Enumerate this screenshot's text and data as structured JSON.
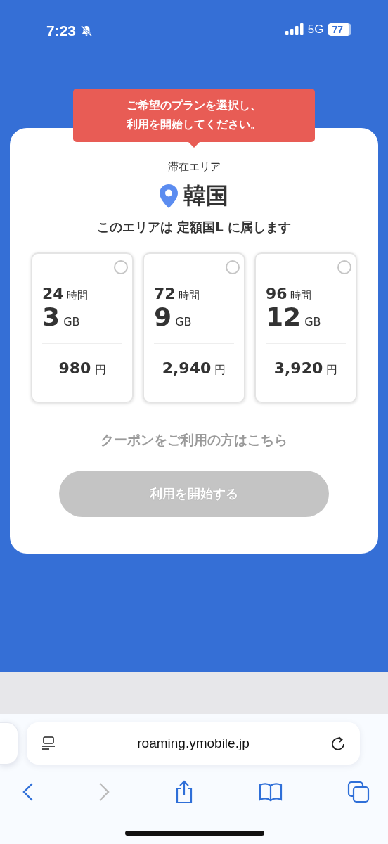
{
  "status_bar": {
    "time": "7:23",
    "network": "5G",
    "battery": "77"
  },
  "tooltip": {
    "lines": [
      "ご希望のプランを選択し、",
      "利用を開始してください。"
    ]
  },
  "area": {
    "label": "滞在エリア",
    "country": "韓国",
    "note": "このエリアは 定額国L に属します"
  },
  "plans": [
    {
      "hours": "24",
      "hours_unit": "時間",
      "data": "3",
      "data_unit": "GB",
      "price": "980",
      "currency": "円",
      "selected": false
    },
    {
      "hours": "72",
      "hours_unit": "時間",
      "data": "9",
      "data_unit": "GB",
      "price": "2,940",
      "currency": "円",
      "selected": false
    },
    {
      "hours": "96",
      "hours_unit": "時間",
      "data": "12",
      "data_unit": "GB",
      "price": "3,920",
      "currency": "円",
      "selected": false
    }
  ],
  "coupon_link": {
    "label": "クーポンをご利用の方はこちら",
    "disabled": true
  },
  "start_button": {
    "label": "利用を開始する",
    "disabled": true
  },
  "browser": {
    "url": "roaming.ymobile.jp",
    "forward_disabled": true
  }
}
